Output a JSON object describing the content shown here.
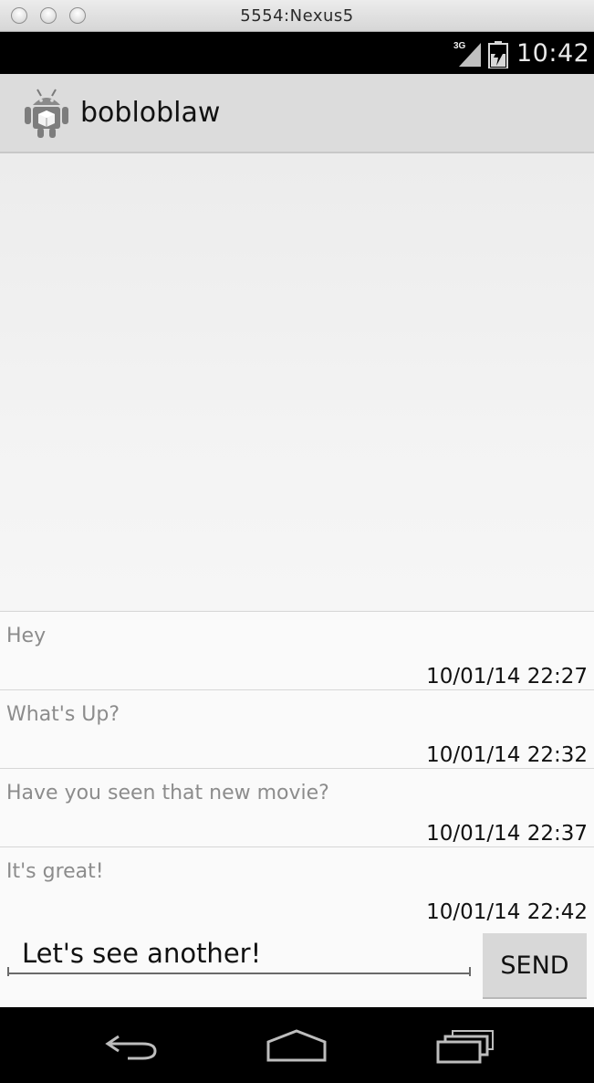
{
  "window": {
    "title": "5554:Nexus5"
  },
  "status_bar": {
    "network": "3G",
    "time": "10:42",
    "icons": [
      "signal-icon",
      "battery-icon"
    ]
  },
  "action_bar": {
    "title": "bobloblaw",
    "icon": "android-app-icon"
  },
  "messages": [
    {
      "text": "Hey",
      "time": "10/01/14 22:27"
    },
    {
      "text": "What's Up?",
      "time": "10/01/14 22:32"
    },
    {
      "text": "Have you seen that new movie?",
      "time": "10/01/14 22:37"
    },
    {
      "text": "It's great!",
      "time": "10/01/14 22:42"
    }
  ],
  "compose": {
    "value": "Let's see another!",
    "send_label": "SEND"
  },
  "nav_bar": {
    "icons": [
      "back-icon",
      "home-icon",
      "recent-apps-icon"
    ]
  }
}
